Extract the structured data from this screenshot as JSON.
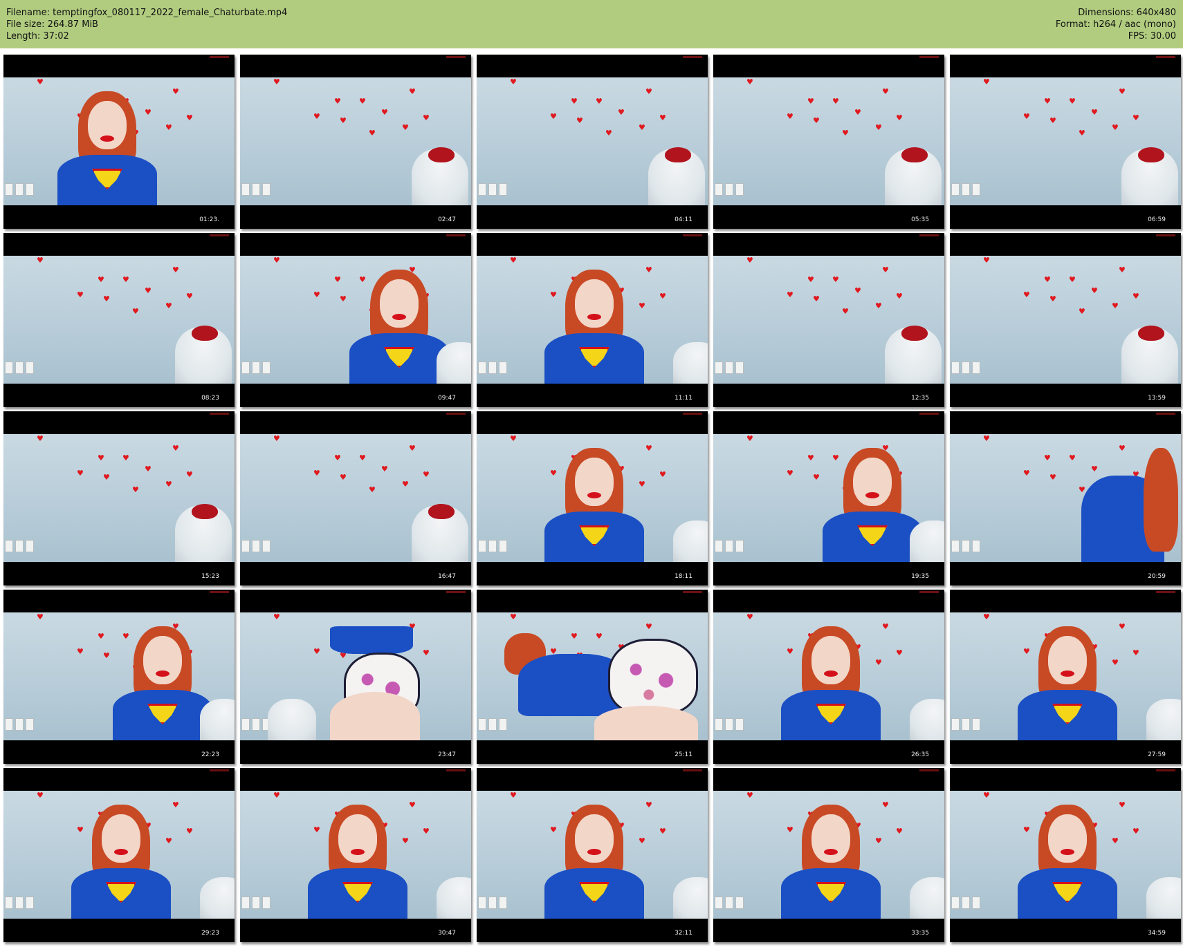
{
  "header": {
    "filename": "Filename: temptingfox_080117_2022_female_Chaturbate.mp4",
    "filesize": "File size: 264.87 MiB",
    "length": "Length: 37:02",
    "dimensions": "Dimensions: 640x480",
    "format": "Format: h264 / aac (mono)",
    "fps": "FPS: 30.00"
  },
  "thumbnails": [
    {
      "time": "01:23."
    },
    {
      "time": "02:47"
    },
    {
      "time": "04:11"
    },
    {
      "time": "05:35"
    },
    {
      "time": "06:59"
    },
    {
      "time": "08:23"
    },
    {
      "time": "09:47"
    },
    {
      "time": "11:11"
    },
    {
      "time": "12:35"
    },
    {
      "time": "13:59"
    },
    {
      "time": "15:23"
    },
    {
      "time": "16:47"
    },
    {
      "time": "18:11"
    },
    {
      "time": "19:35"
    },
    {
      "time": "20:59"
    },
    {
      "time": "22:23"
    },
    {
      "time": "23:47"
    },
    {
      "time": "25:11"
    },
    {
      "time": "26:35"
    },
    {
      "time": "27:59"
    },
    {
      "time": "29:23"
    },
    {
      "time": "30:47"
    },
    {
      "time": "32:11"
    },
    {
      "time": "33:35"
    },
    {
      "time": "34:59"
    }
  ],
  "colors": {
    "header_bg": "#b1cc7f",
    "wall": "#b8cdd9",
    "shirt": "#1b4fc4",
    "hair": "#c84a25",
    "heart": "#e0191f"
  }
}
